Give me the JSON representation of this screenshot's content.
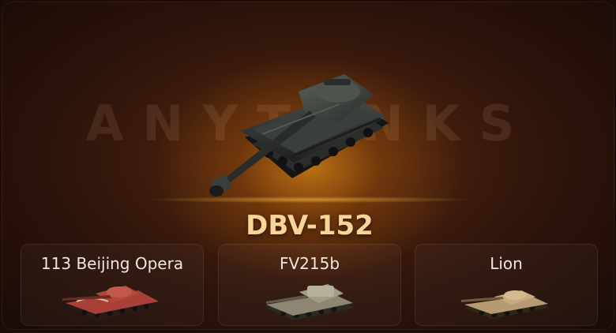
{
  "watermark": "ANYTANKS",
  "main_tank": {
    "name": "DBV-152",
    "icon": "heavy-tank-image"
  },
  "variants": [
    {
      "name": "113 Beijing Opera",
      "icon": "red-camouflage-tank-image"
    },
    {
      "name": "FV215b",
      "icon": "spg-tank-image"
    },
    {
      "name": "Lion",
      "icon": "tan-tank-image"
    }
  ],
  "colors": {
    "title": "#f6d49a",
    "glow": "#cd7d14",
    "background": "#2d140b"
  }
}
